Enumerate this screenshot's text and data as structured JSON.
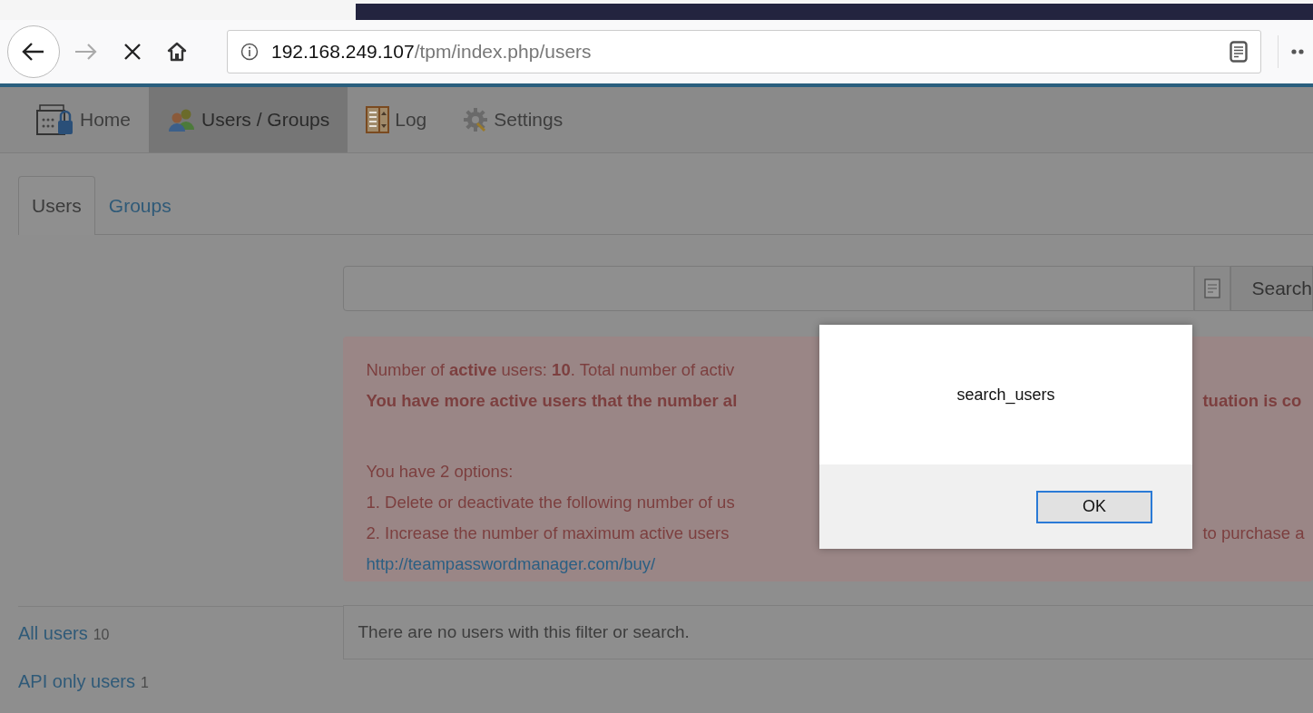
{
  "browser": {
    "address": {
      "host": "192.168.249.107",
      "path": "/tpm/index.php/users"
    }
  },
  "nav": [
    {
      "label": "Home",
      "selected": false
    },
    {
      "label": "Users / Groups",
      "selected": true
    },
    {
      "label": "Log",
      "selected": false
    },
    {
      "label": "Settings",
      "selected": false
    }
  ],
  "tabs": [
    {
      "label": "Users",
      "selected": true
    },
    {
      "label": "Groups",
      "selected": false
    }
  ],
  "search": {
    "button": "Search"
  },
  "alert": {
    "lines": [
      {
        "kind": "text",
        "left": "Number of **active** users: **10**. Total number of activ"
      },
      {
        "kind": "bold",
        "left": "You have more active users that the number al",
        "right": "tuation is co"
      },
      {
        "kind": "blank"
      },
      {
        "kind": "text",
        "left": "You have 2 options:"
      },
      {
        "kind": "text",
        "left": "1. Delete or deactivate the following number of us"
      },
      {
        "kind": "text",
        "left": "2. Increase the number of maximum active users",
        "right": "to purchase a"
      },
      {
        "kind": "link",
        "left": "http://teampasswordmanager.com/buy/"
      }
    ]
  },
  "filters": [
    {
      "label": "All users",
      "count": "10"
    },
    {
      "label": "API only users",
      "count": "1"
    }
  ],
  "results": {
    "message": "There are no users with this filter or search."
  },
  "dialog": {
    "message": "search_users",
    "button": "OK"
  }
}
